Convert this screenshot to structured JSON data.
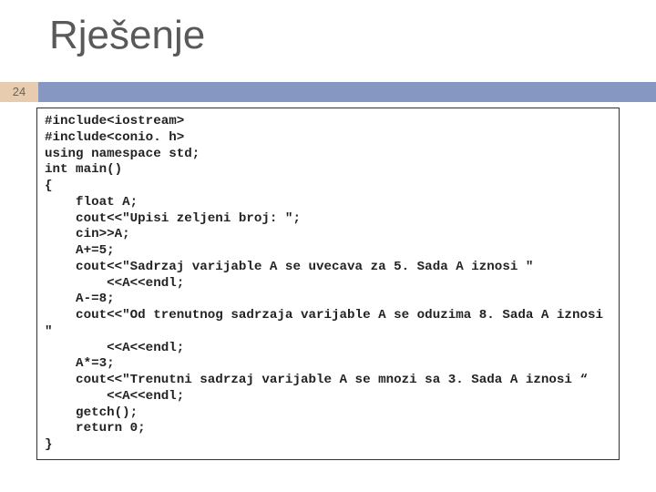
{
  "title": "Rješenje",
  "slide_number": "24",
  "code": "#include<iostream>\n#include<conio. h>\nusing namespace std;\nint main()\n{\n    float A;\n    cout<<\"Upisi zeljeni broj: \";\n    cin>>A;\n    A+=5;\n    cout<<\"Sadrzaj varijable A se uvecava za 5. Sada A iznosi \"\n        <<A<<endl;\n    A-=8;\n    cout<<\"Od trenutnog sadrzaja varijable A se oduzima 8. Sada A iznosi\n\"\n        <<A<<endl;\n    A*=3;\n    cout<<\"Trenutni sadrzaj varijable A se mnozi sa 3. Sada A iznosi “\n        <<A<<endl;\n    getch();\n    return 0;\n}"
}
